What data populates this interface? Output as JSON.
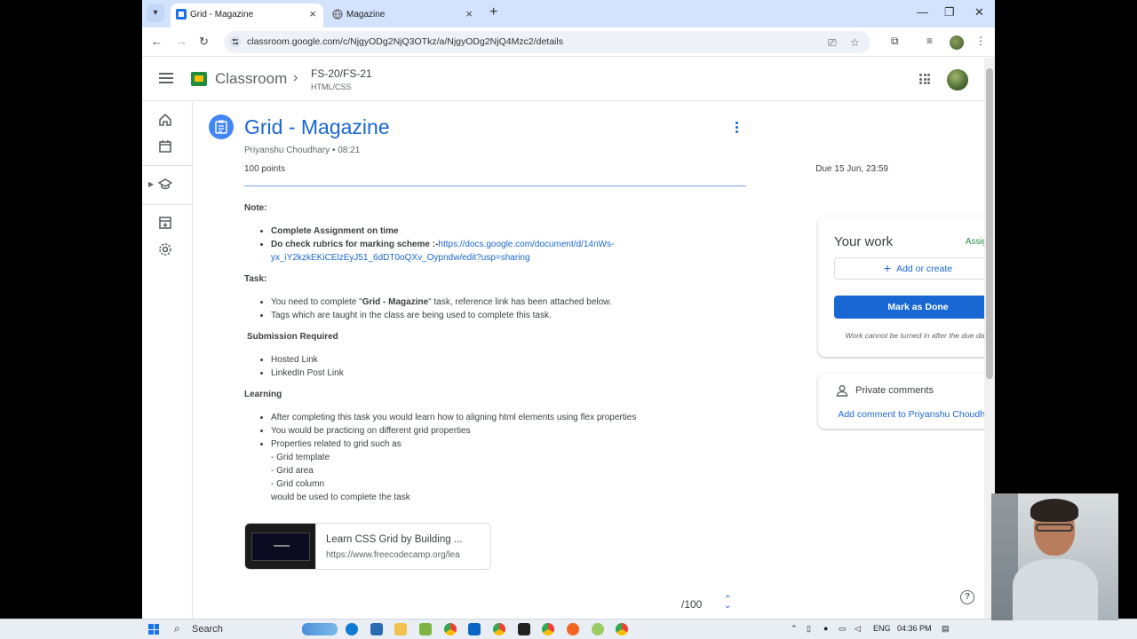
{
  "browser": {
    "tabs": [
      {
        "title": "Grid - Magazine",
        "active": true
      },
      {
        "title": "Magazine",
        "active": false
      }
    ],
    "url": "classroom.google.com/c/NjgyODg2NjQ3OTkz/a/NjgyODg2NjQ4Mzc2/details"
  },
  "header": {
    "app_name": "Classroom",
    "class_name": "FS-20/FS-21",
    "section": "HTML/CSS"
  },
  "assignment": {
    "title": "Grid - Magazine",
    "meta": "Priyanshu Choudhary • 08:21",
    "points": "100 points",
    "due": "Due 15 Jun, 23:59",
    "note_heading": "Note:",
    "note_item1": "Complete Assignment on time",
    "note_item2_label": "Do check rubrics for marking scheme :-",
    "note_item2_link": "https://docs.google.com/document/d/14nWs-yx_iY2kzkEKiCElzEyJ51_6dDT0oQXv_Oypndw/edit?usp=sharing",
    "task_heading": "Task:",
    "task_item1_pre": "You need to complete \"",
    "task_item1_bold": "Grid - Magazine",
    "task_item1_post": "\" task, reference link has been attached below.",
    "task_item2": "Tags which are taught in the class are being used to complete this task.",
    "submission_heading": "Submission Required",
    "submission_items": [
      "Hosted Link",
      "LinkedIn Post Link"
    ],
    "learning_heading": "Learning",
    "learning_item1": "After completing this task you would learn how to aligning html elements using flex properties",
    "learning_item2": "You would be practicing on different grid properties",
    "learning_item3": "Properties related to grid such as",
    "learning_sub": [
      "- Grid template",
      "- Grid area",
      "- Grid column",
      "would be used to complete the task"
    ],
    "attachment_title": "Learn CSS Grid by Building ...",
    "attachment_url": "https://www.freecodecamp.org/lea",
    "grade": "/100"
  },
  "your_work": {
    "title": "Your work",
    "status": "Assigned",
    "add_label": "Add or create",
    "done_label": "Mark as Done",
    "note": "Work cannot be turned in after the due date"
  },
  "private_comments": {
    "title": "Private comments",
    "add_label": "Add comment to Priyanshu Choudhary"
  },
  "taskbar": {
    "search": "Search",
    "lang": "ENG",
    "time": "04:36 PM"
  },
  "colors": {
    "accent": "#1967d2",
    "assigned": "#1e8e3e",
    "tab_strip": "#d3e3fd"
  }
}
